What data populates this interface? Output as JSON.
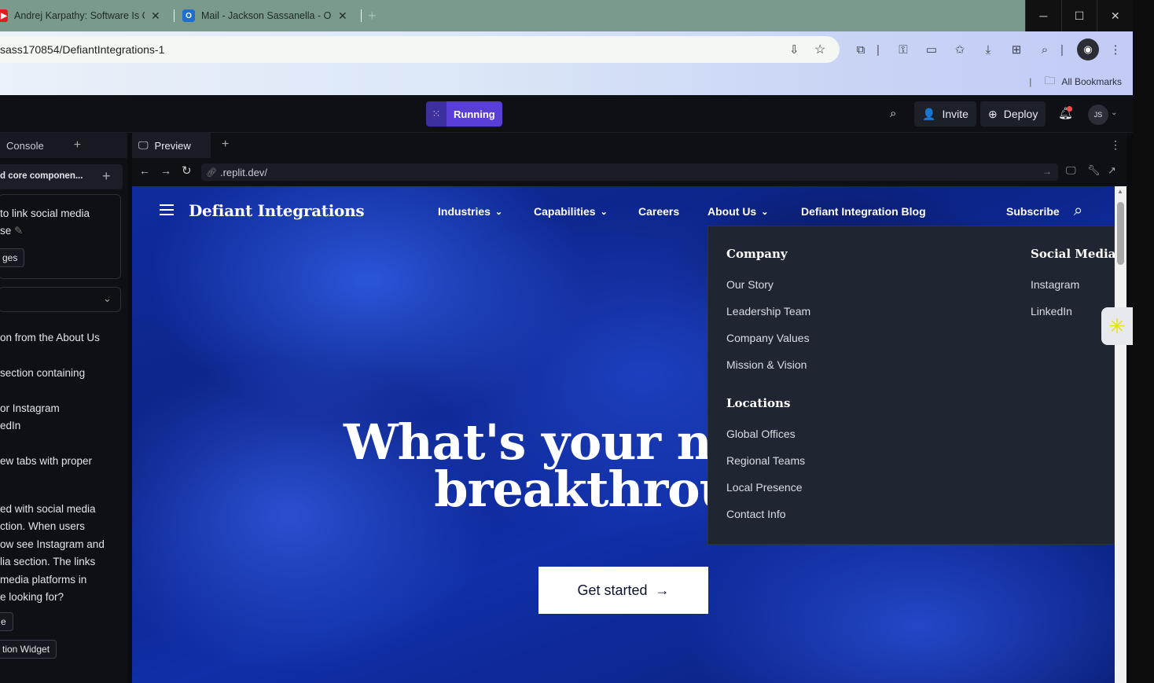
{
  "browser": {
    "tabs": [
      {
        "title": "Andrej Karpathy: Software Is Ch",
        "icon": "youtube-icon"
      },
      {
        "title": "Mail - Jackson Sassanella - Out",
        "icon": "outlook-icon"
      }
    ],
    "new_tab": "+",
    "url": "sass170854/DefiantIntegrations-1",
    "bookmarks_label": "All Bookmarks"
  },
  "replit": {
    "run_label": "Running",
    "invite_label": "Invite",
    "deploy_label": "Deploy",
    "avatar_initials": "JS"
  },
  "left_panel": {
    "tab_label": "Console",
    "thread_title": "d core componen...",
    "lines": [
      "to link social media",
      "se",
      "ges",
      "on from the About Us",
      "section containing",
      "or Instagram",
      "edIn",
      "ew tabs with proper",
      "ed with social media",
      "ction. When users",
      "ow see Instagram and",
      "lia section. The links",
      "media platforms in",
      "e looking for?",
      "e",
      "tion Widget"
    ]
  },
  "preview": {
    "tab_label": "Preview",
    "url": ".replit.dev/"
  },
  "site": {
    "brand": "Defiant Integrations",
    "nav": {
      "industries": "Industries",
      "capabilities": "Capabilities",
      "careers": "Careers",
      "about": "About Us",
      "blog": "Defiant Integration Blog",
      "subscribe": "Subscribe"
    },
    "hero_line1": "What's your next",
    "hero_line1_partial": "r",
    "hero_line2": "breakthrou",
    "cta": "Get started",
    "dropdown": {
      "company_heading": "Company",
      "company_links": [
        "Our Story",
        "Leadership Team",
        "Company Values",
        "Mission & Vision"
      ],
      "locations_heading": "Locations",
      "locations_links": [
        "Global Offices",
        "Regional Teams",
        "Local Presence",
        "Contact Info"
      ],
      "social_heading": "Social Media",
      "social_links": [
        "Instagram",
        "LinkedIn"
      ]
    }
  },
  "colors": {
    "tabstrip": "#7a9a8c",
    "replit_bg": "#0e1016",
    "run_accent": "#5a3fd6",
    "dropdown_bg": "#1f2631",
    "hero_blue": "#0f2c9e"
  }
}
